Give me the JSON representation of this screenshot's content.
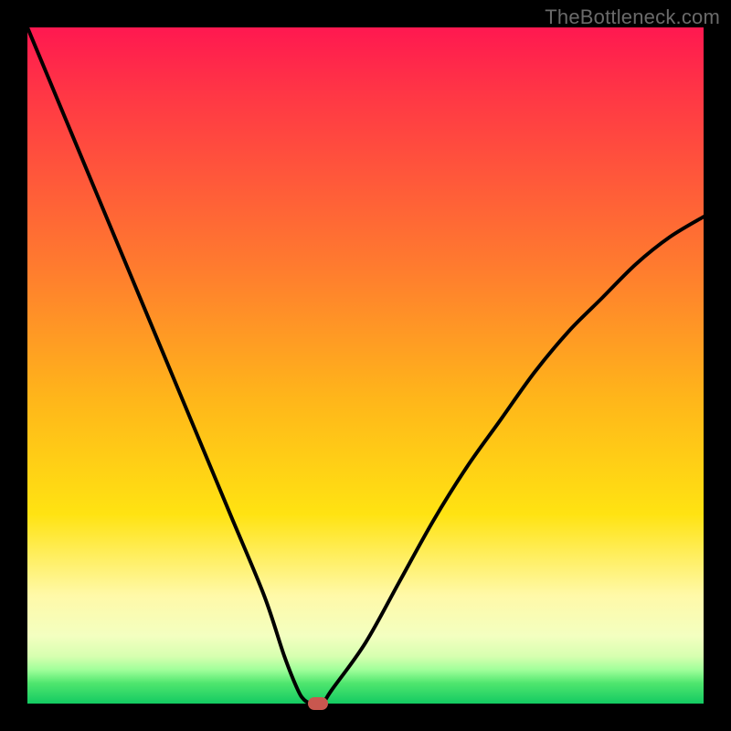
{
  "watermark": "TheBottleneck.com",
  "chart_data": {
    "type": "line",
    "title": "",
    "xlabel": "",
    "ylabel": "",
    "x_range": [
      0,
      100
    ],
    "y_range": [
      0,
      100
    ],
    "series": [
      {
        "name": "bottleneck-curve",
        "x": [
          0,
          5,
          10,
          15,
          20,
          25,
          30,
          35,
          38,
          40,
          41,
          42,
          43,
          44,
          45,
          50,
          55,
          60,
          65,
          70,
          75,
          80,
          85,
          90,
          95,
          100
        ],
        "y": [
          100,
          88,
          76,
          64,
          52,
          40,
          28,
          16,
          7,
          2,
          0.5,
          0,
          0,
          0.5,
          2,
          9,
          18,
          27,
          35,
          42,
          49,
          55,
          60,
          65,
          69,
          72
        ]
      }
    ],
    "flat_segment": {
      "x_start": 41,
      "x_end": 44,
      "y": 0
    },
    "marker": {
      "x": 43,
      "y": 0,
      "color": "#c9574f"
    },
    "background_gradient": {
      "stops": [
        {
          "pos": 0.0,
          "color": "#ff1850"
        },
        {
          "pos": 0.1,
          "color": "#ff3745"
        },
        {
          "pos": 0.35,
          "color": "#ff7a2f"
        },
        {
          "pos": 0.55,
          "color": "#ffb61a"
        },
        {
          "pos": 0.72,
          "color": "#ffe312"
        },
        {
          "pos": 0.84,
          "color": "#fff9a8"
        },
        {
          "pos": 0.9,
          "color": "#f3ffc0"
        },
        {
          "pos": 0.93,
          "color": "#d7ffb0"
        },
        {
          "pos": 0.95,
          "color": "#a0ff9a"
        },
        {
          "pos": 0.97,
          "color": "#4fe66e"
        },
        {
          "pos": 1.0,
          "color": "#13ca62"
        }
      ]
    },
    "frame": {
      "border_color": "#000000",
      "border_width_px": 30
    }
  }
}
